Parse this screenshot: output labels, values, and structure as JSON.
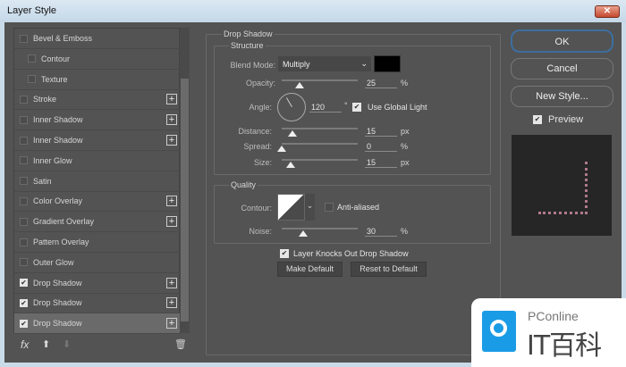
{
  "window": {
    "title": "Layer Style",
    "close_icon": "close-icon"
  },
  "effects": [
    {
      "label": "Bevel & Emboss",
      "checked": false,
      "plus": false,
      "indent": false
    },
    {
      "label": "Contour",
      "checked": false,
      "plus": false,
      "indent": true
    },
    {
      "label": "Texture",
      "checked": false,
      "plus": false,
      "indent": true
    },
    {
      "label": "Stroke",
      "checked": false,
      "plus": true,
      "indent": false
    },
    {
      "label": "Inner Shadow",
      "checked": false,
      "plus": true,
      "indent": false
    },
    {
      "label": "Inner Shadow",
      "checked": false,
      "plus": true,
      "indent": false
    },
    {
      "label": "Inner Glow",
      "checked": false,
      "plus": false,
      "indent": false
    },
    {
      "label": "Satin",
      "checked": false,
      "plus": false,
      "indent": false
    },
    {
      "label": "Color Overlay",
      "checked": false,
      "plus": true,
      "indent": false
    },
    {
      "label": "Gradient Overlay",
      "checked": false,
      "plus": true,
      "indent": false
    },
    {
      "label": "Pattern Overlay",
      "checked": false,
      "plus": false,
      "indent": false
    },
    {
      "label": "Outer Glow",
      "checked": false,
      "plus": false,
      "indent": false
    },
    {
      "label": "Drop Shadow",
      "checked": true,
      "plus": true,
      "indent": false
    },
    {
      "label": "Drop Shadow",
      "checked": true,
      "plus": true,
      "indent": false
    },
    {
      "label": "Drop Shadow",
      "checked": true,
      "plus": true,
      "indent": false,
      "selected": true
    }
  ],
  "footer": {
    "fx": "fx",
    "up_icon": "arrow-up-icon",
    "down_icon": "arrow-down-icon",
    "trash_icon": "trash-icon"
  },
  "panel": {
    "title": "Drop Shadow",
    "structure": {
      "title": "Structure",
      "blend_label": "Blend Mode:",
      "blend_value": "Multiply",
      "shadow_color": "#000000",
      "opacity_label": "Opacity:",
      "opacity": "25",
      "opacity_unit": "%",
      "angle_label": "Angle:",
      "angle": "120",
      "angle_unit": "°",
      "global_light": "Use Global Light",
      "distance_label": "Distance:",
      "distance": "15",
      "distance_unit": "px",
      "spread_label": "Spread:",
      "spread": "0",
      "spread_unit": "%",
      "size_label": "Size:",
      "size": "15",
      "size_unit": "px"
    },
    "quality": {
      "title": "Quality",
      "contour_label": "Contour:",
      "anti_aliased": "Anti-aliased",
      "noise_label": "Noise:",
      "noise": "30",
      "noise_unit": "%"
    },
    "knockout": "Layer Knocks Out Drop Shadow",
    "make_default": "Make Default",
    "reset_default": "Reset to Default"
  },
  "actions": {
    "ok": "OK",
    "cancel": "Cancel",
    "new_style": "New Style...",
    "preview": "Preview"
  },
  "watermark": {
    "brand": "PConline",
    "name": "IT百科",
    "color": "#1a9be6"
  }
}
